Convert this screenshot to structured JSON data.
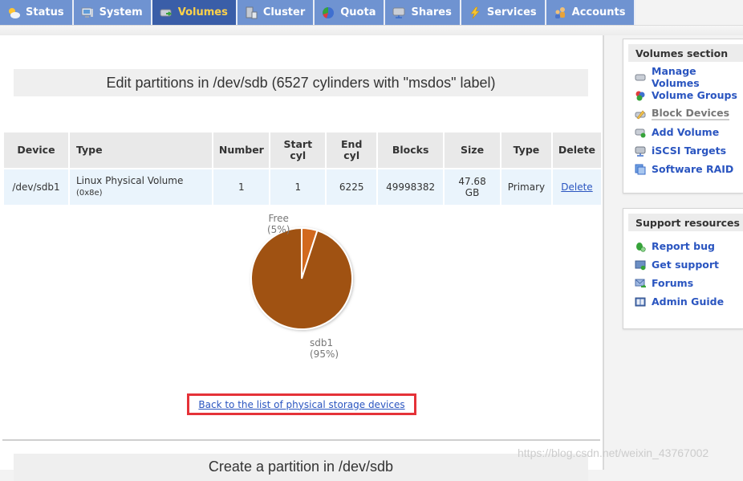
{
  "nav": {
    "tabs": [
      {
        "label": "Status",
        "icon": "weather-icon",
        "active": false
      },
      {
        "label": "System",
        "icon": "computer-icon",
        "active": false
      },
      {
        "label": "Volumes",
        "icon": "drive-icon",
        "active": true
      },
      {
        "label": "Cluster",
        "icon": "server-icon",
        "active": false
      },
      {
        "label": "Quota",
        "icon": "pie-icon",
        "active": false
      },
      {
        "label": "Shares",
        "icon": "network-drive-icon",
        "active": false
      },
      {
        "label": "Services",
        "icon": "lightning-icon",
        "active": false
      },
      {
        "label": "Accounts",
        "icon": "users-icon",
        "active": false
      }
    ]
  },
  "main": {
    "title": "Edit partitions in /dev/sdb (6527 cylinders with \"msdos\" label)",
    "table": {
      "headers": [
        "Device",
        "Type",
        "Number",
        "Start\ncyl",
        "End\ncyl",
        "Blocks",
        "Size",
        "Type",
        "Delete"
      ],
      "header_lines": {
        "start_cyl": [
          "Start",
          "cyl"
        ],
        "end_cyl": [
          "End",
          "cyl"
        ]
      },
      "rows": [
        {
          "device": "/dev/sdb1",
          "type": "Linux Physical Volume",
          "type_code": "(0x8e)",
          "number": "1",
          "start_cyl": "1",
          "end_cyl": "6225",
          "blocks": "49998382",
          "size_value": "47.68",
          "size_unit": "GB",
          "ptype": "Primary",
          "delete": "Delete"
        }
      ]
    },
    "back_link": "Back to the list of physical storage devices",
    "sub_title": "Create a partition in /dev/sdb"
  },
  "chart_data": {
    "type": "pie",
    "slices": [
      {
        "label": "sdb1",
        "percent_label": "(95%)",
        "value": 95,
        "color": "#a05212"
      },
      {
        "label": "Free",
        "percent_label": "(5%)",
        "value": 5,
        "color": "#d2691e"
      }
    ]
  },
  "sidebar": {
    "volumes": {
      "title": "Volumes section",
      "items": [
        {
          "label": "Manage Volumes",
          "icon": "drive-icon",
          "current": false
        },
        {
          "label": "Volume Groups",
          "icon": "groups-icon",
          "current": false
        },
        {
          "label": "Block Devices",
          "icon": "edit-drive-icon",
          "current": true
        },
        {
          "label": "Add Volume",
          "icon": "add-drive-icon",
          "current": false
        },
        {
          "label": "iSCSI Targets",
          "icon": "iscsi-icon",
          "current": false
        },
        {
          "label": "Software RAID",
          "icon": "raid-icon",
          "current": false
        }
      ]
    },
    "support": {
      "title": "Support resources",
      "items": [
        {
          "label": "Report bug",
          "icon": "bug-icon"
        },
        {
          "label": "Get support",
          "icon": "support-icon"
        },
        {
          "label": "Forums",
          "icon": "forums-icon"
        },
        {
          "label": "Admin Guide",
          "icon": "book-icon"
        }
      ]
    }
  },
  "watermark": "https://blog.csdn.net/weixin_43767002"
}
